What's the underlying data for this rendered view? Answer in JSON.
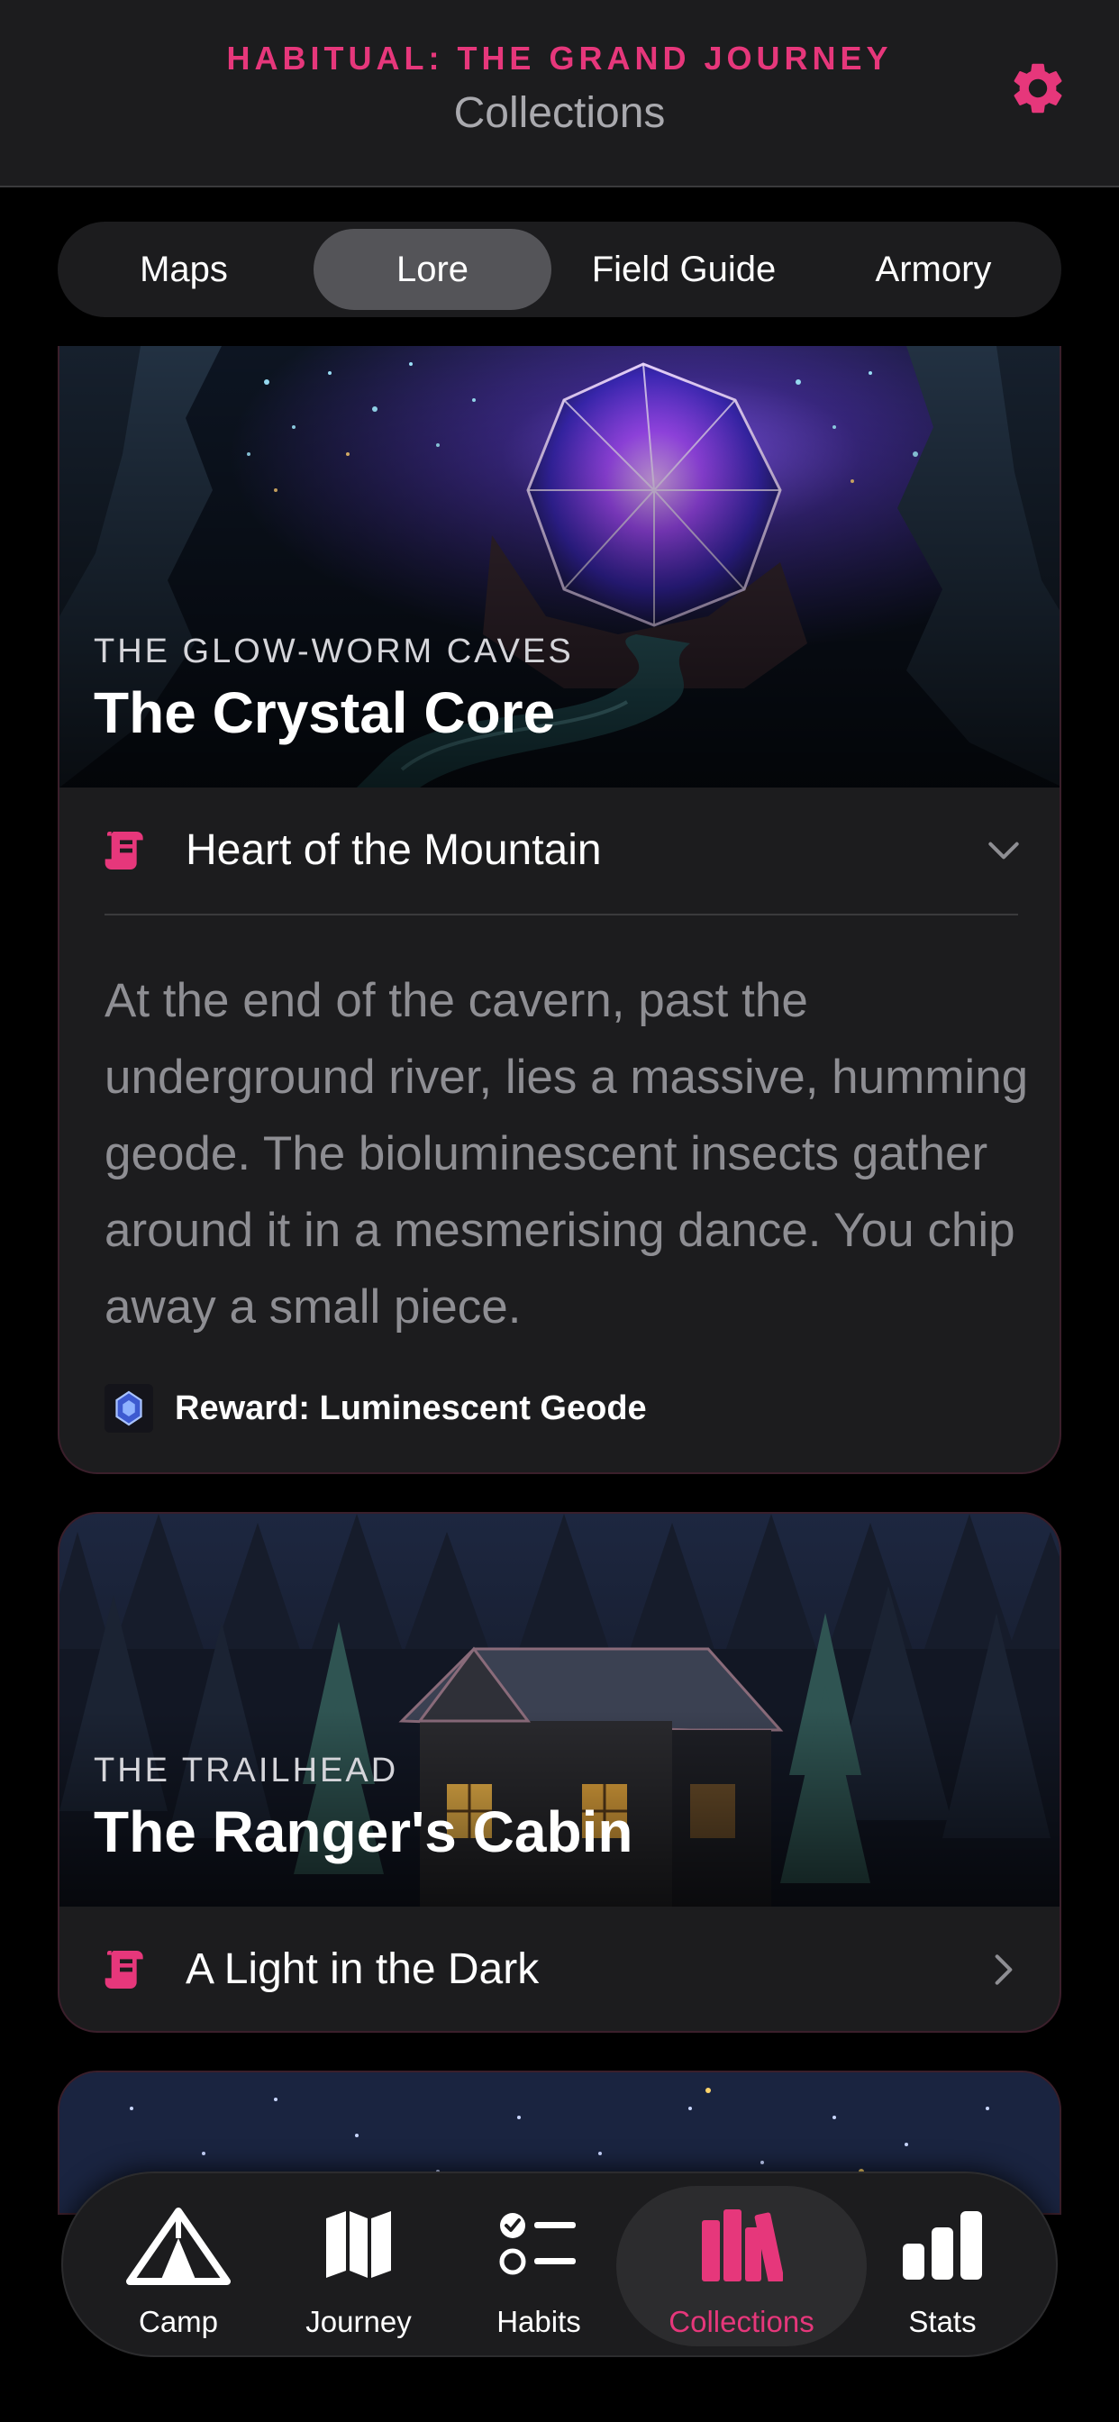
{
  "header": {
    "app_title": "HABITUAL: THE GRAND JOURNEY",
    "screen_title": "Collections",
    "settings_icon": "gear-icon",
    "accent": "#e6377b"
  },
  "segments": [
    {
      "label": "Maps",
      "active": false
    },
    {
      "label": "Lore",
      "active": true
    },
    {
      "label": "Field Guide",
      "active": false
    },
    {
      "label": "Armory",
      "active": false
    }
  ],
  "lore_cards": [
    {
      "location": "THE GLOW-WORM CAVES",
      "title": "The Crystal Core",
      "entry_title": "Heart of the Mountain",
      "expanded": true,
      "icon": "scroll-icon",
      "text": "At the end of the cavern, past the underground river, lies a massive, humming geode. The bioluminescent insects gather around it in a mesmerising dance. You chip away a small piece.",
      "reward": "Reward: Luminescent Geode"
    },
    {
      "location": "THE TRAILHEAD",
      "title": "The Ranger's Cabin",
      "entry_title": "A Light in the Dark",
      "expanded": false,
      "icon": "scroll-icon"
    }
  ],
  "tabbar": [
    {
      "label": "Camp",
      "icon": "tent-icon",
      "active": false
    },
    {
      "label": "Journey",
      "icon": "map-icon",
      "active": false
    },
    {
      "label": "Habits",
      "icon": "checklist-icon",
      "active": false
    },
    {
      "label": "Collections",
      "icon": "books-icon",
      "active": true
    },
    {
      "label": "Stats",
      "icon": "bar-chart-icon",
      "active": false
    }
  ]
}
